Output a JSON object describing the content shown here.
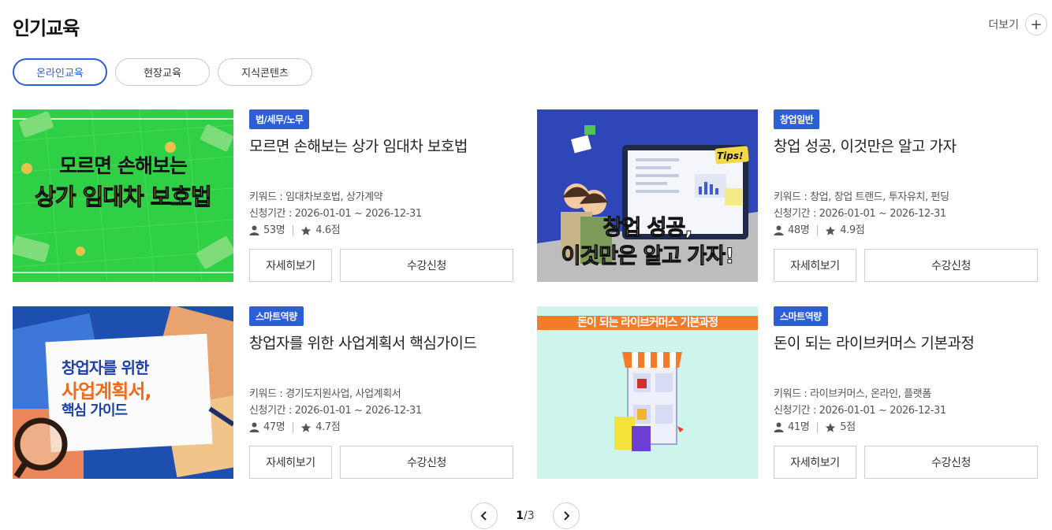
{
  "section": {
    "title": "인기교육",
    "more_label": "더보기",
    "more_icon": "+"
  },
  "tabs": [
    {
      "label": "온라인교육",
      "active": true
    },
    {
      "label": "현장교육",
      "active": false
    },
    {
      "label": "지식콘텐츠",
      "active": false
    }
  ],
  "cards": [
    {
      "badge": "법/세무/노무",
      "title": "모르면 손해보는 상가 임대차 보호법",
      "keywords": "키워드 : 임대차보호법, 상가계약",
      "period": "신청기간 : 2026-01-01 ~ 2026-12-31",
      "students": "53명",
      "rating": "4.6점",
      "thumb_line1": "모르면 손해보는",
      "thumb_line2": "상가 임대차 보호법",
      "detail_label": "자세히보기",
      "apply_label": "수강신청"
    },
    {
      "badge": "창업일반",
      "title": "창업 성공, 이것만은 알고 가자",
      "keywords": "키워드 : 창업, 창업 트랜드, 투자유치, 펀딩",
      "period": "신청기간 : 2026-01-01 ~ 2026-12-31",
      "students": "48명",
      "rating": "4.9점",
      "thumb_line1": "창업 성공,",
      "thumb_line2": "이것만은 알고 가자!",
      "thumb_tag": "Tips!",
      "detail_label": "자세히보기",
      "apply_label": "수강신청"
    },
    {
      "badge": "스마트역량",
      "title": "창업자를 위한 사업계획서 핵심가이드",
      "keywords": "키워드 : 경기도지원사업, 사업계획서",
      "period": "신청기간 : 2026-01-01 ~ 2026-12-31",
      "students": "47명",
      "rating": "4.7점",
      "thumb_line1": "창업자를 위한",
      "thumb_line2": "사업계획서,",
      "thumb_line3": "핵심 가이드",
      "detail_label": "자세히보기",
      "apply_label": "수강신청"
    },
    {
      "badge": "스마트역량",
      "title": "돈이 되는 라이브커머스 기본과정",
      "keywords": "키워드 : 라이브커머스, 온라인, 플랫폼",
      "period": "신청기간 : 2026-01-01 ~ 2026-12-31",
      "students": "41명",
      "rating": "5점",
      "thumb_line1": "돈이 되는 라이브커머스 기본과정",
      "detail_label": "자세히보기",
      "apply_label": "수강신청"
    }
  ],
  "pagination": {
    "current": "1",
    "total": "3",
    "separator": "/"
  },
  "colors": {
    "accent": "#2c5fd6",
    "green_thumb": "#2fd045",
    "blue_thumb": "#2f46b8",
    "mint_thumb": "#cdf5ec",
    "orange_banner": "#f57a2a"
  }
}
